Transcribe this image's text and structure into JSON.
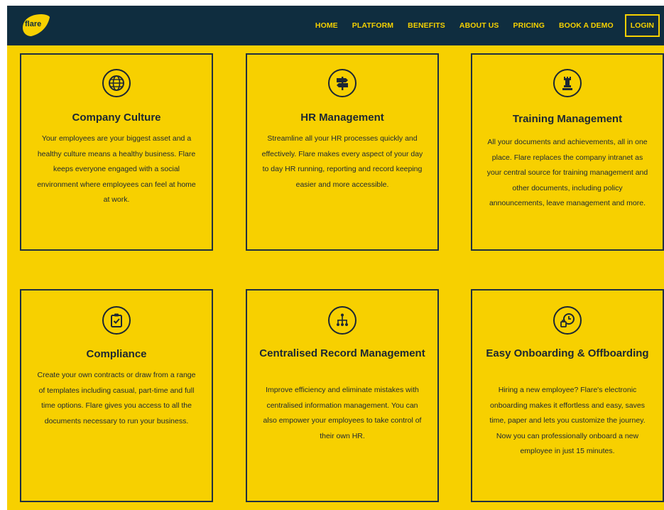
{
  "nav": {
    "logo_text": "flare",
    "items": [
      {
        "label": "HOME"
      },
      {
        "label": "PLATFORM"
      },
      {
        "label": "BENEFITS"
      },
      {
        "label": "ABOUT US"
      },
      {
        "label": "PRICING"
      },
      {
        "label": "BOOK A DEMO"
      }
    ],
    "login_label": "LOGIN"
  },
  "colors": {
    "nav_background": "#0f2d3f",
    "accent_yellow": "#f7d000",
    "text_dark": "#1c2733"
  },
  "features": [
    {
      "icon": "globe-icon",
      "title": "Company Culture",
      "text": "Your employees are your biggest asset and a healthy culture means a healthy business. Flare keeps everyone engaged with a social environment where employees can feel at home at work."
    },
    {
      "icon": "signpost-icon",
      "title": "HR Management",
      "text": "Streamline all your HR processes quickly and effectively. Flare makes every aspect of your day to day HR running, reporting and record keeping easier and more accessible."
    },
    {
      "icon": "chess-rook-icon",
      "title": "Training Management",
      "text": "All your documents and achievements, all in one place. Flare replaces the company intranet as your central source for training management and other documents, including policy announcements, leave management and more."
    },
    {
      "icon": "clipboard-check-icon",
      "title": "Compliance",
      "text": "Create your own contracts or draw from a range of templates including casual, part-time and full time options. Flare gives you access to all the documents necessary to run your business."
    },
    {
      "icon": "hierarchy-icon",
      "title": "Centralised Record Management",
      "text": "Improve efficiency and eliminate mistakes with centralised information management. You can also empower your employees to take control of their own HR."
    },
    {
      "icon": "clock-handoff-icon",
      "title": "Easy Onboarding & Offboarding",
      "text": "Hiring a new employee? Flare's electronic onboarding makes it effortless and easy, saves time, paper and lets you customize the journey. Now you can professionally onboard a new employee in just 15 minutes."
    }
  ]
}
